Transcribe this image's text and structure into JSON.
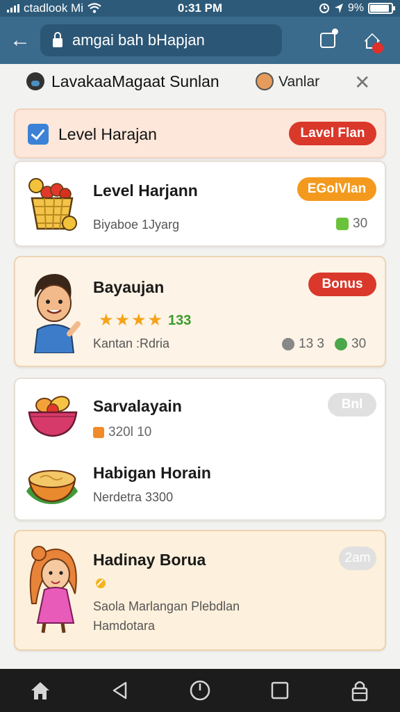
{
  "status_bar": {
    "carrier": "ctadlook Mi",
    "time": "0:31 PM",
    "battery": "9%",
    "battery_level": 0.9
  },
  "url_bar": {
    "url": "amgai bah bHapjan"
  },
  "account": {
    "name": "LavakaaMagaat Sunlan",
    "user": "Vanlar"
  },
  "header_card": {
    "title": "Level Harajan",
    "badge": "Lavel Flan",
    "badge_color": "#d9382b"
  },
  "cards": [
    {
      "title": "Level Harjann",
      "subtitle": "Biyaboe 1Jyarg",
      "badge": "EGolVlan",
      "badge_color": "#f39a1e",
      "stat": "30",
      "icon": "money-basket-icon"
    },
    {
      "title": "Bayaujan",
      "rating_value": "133",
      "rating": 4,
      "subtitle": "Kantan :Rdria",
      "badge": "Bonus",
      "badge_color": "#d9382b",
      "stat_a": "13 3",
      "stat_b": "30",
      "icon": "boy-avatar-icon"
    },
    {
      "title": "Sarvalayain",
      "points": "320l 10",
      "badge": "Bnl",
      "title2": "Habigan Horain",
      "subtitle2": "Nerdetra 3300",
      "icon": "fruit-bowl-icon",
      "icon2": "soup-bowl-icon"
    },
    {
      "title": "Hadinay Borua",
      "badge": "2am",
      "line1": "Saola Marlangan Plebdlan",
      "line2": "Hamdotara",
      "icon": "girl-avatar-icon"
    }
  ],
  "colors": {
    "status_bar": "#2d5a79",
    "url_bar": "#3a6a8c",
    "accent_green": "#3a9a2a"
  }
}
